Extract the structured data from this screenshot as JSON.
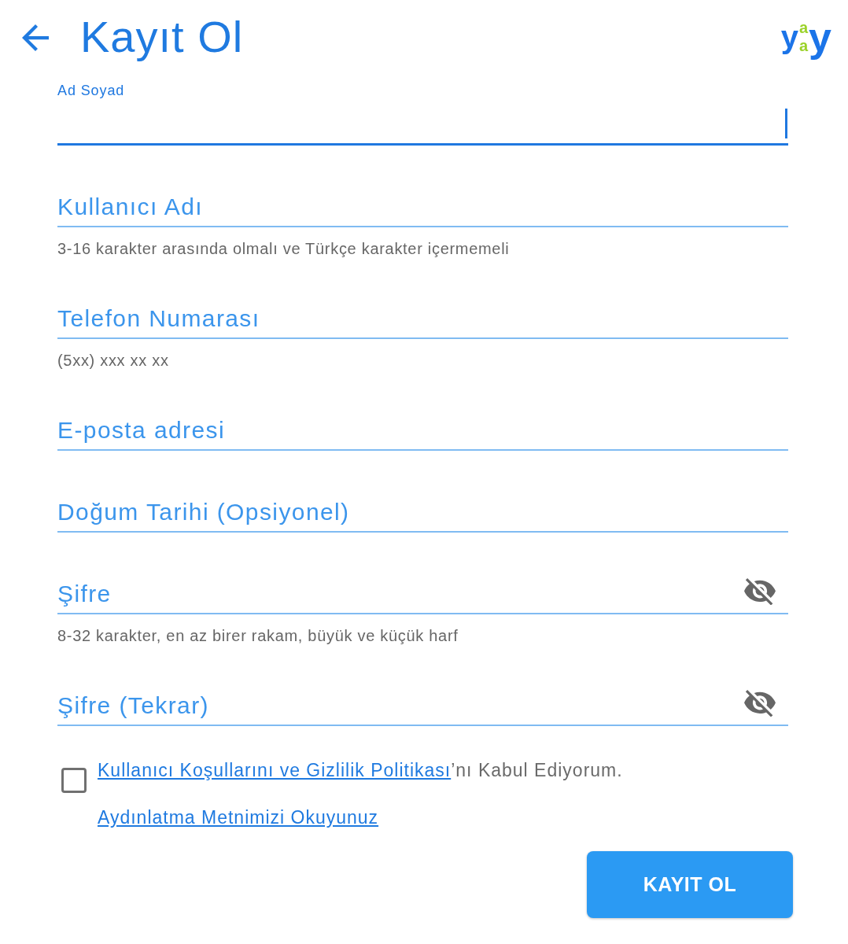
{
  "header": {
    "title": "Kayıt Ol",
    "logo": [
      {
        "kind": "letter",
        "text": "y",
        "color": "#1b74e8"
      },
      {
        "kind": "stack",
        "letters": [
          {
            "text": "a",
            "color": "#9bd22a"
          },
          {
            "text": "a",
            "color": "#9bd22a"
          }
        ]
      },
      {
        "kind": "letter",
        "text": "y",
        "color": "#1b74e8"
      }
    ]
  },
  "fields": [
    {
      "label": "Ad Soyad",
      "kind": "text",
      "focused": true
    },
    {
      "label": "Kullanıcı Adı",
      "kind": "text",
      "focused": false,
      "helper": "3-16 karakter arasında olmalı ve Türkçe karakter içermemeli"
    },
    {
      "label": "Telefon Numarası",
      "kind": "text",
      "focused": false,
      "helper": "(5xx) xxx xx xx"
    },
    {
      "label": "E-posta adresi",
      "kind": "text",
      "focused": false
    },
    {
      "label": "Doğum Tarihi (Opsiyonel)",
      "kind": "text",
      "focused": false
    },
    {
      "label": "Şifre",
      "kind": "password",
      "focused": false,
      "helper": "8-32 karakter, en az birer rakam, büyük ve küçük harf"
    },
    {
      "label": "Şifre (Tekrar)",
      "kind": "password",
      "focused": false
    }
  ],
  "terms": {
    "checked": false,
    "link": "Kullanıcı Koşullarını ve Gizlilik Politikası",
    "text": "’nı Kabul Ediyorum."
  },
  "notice_link": "Aydınlatma Metnimizi Okuyunuz",
  "submit_button": "KAYIT OL"
}
